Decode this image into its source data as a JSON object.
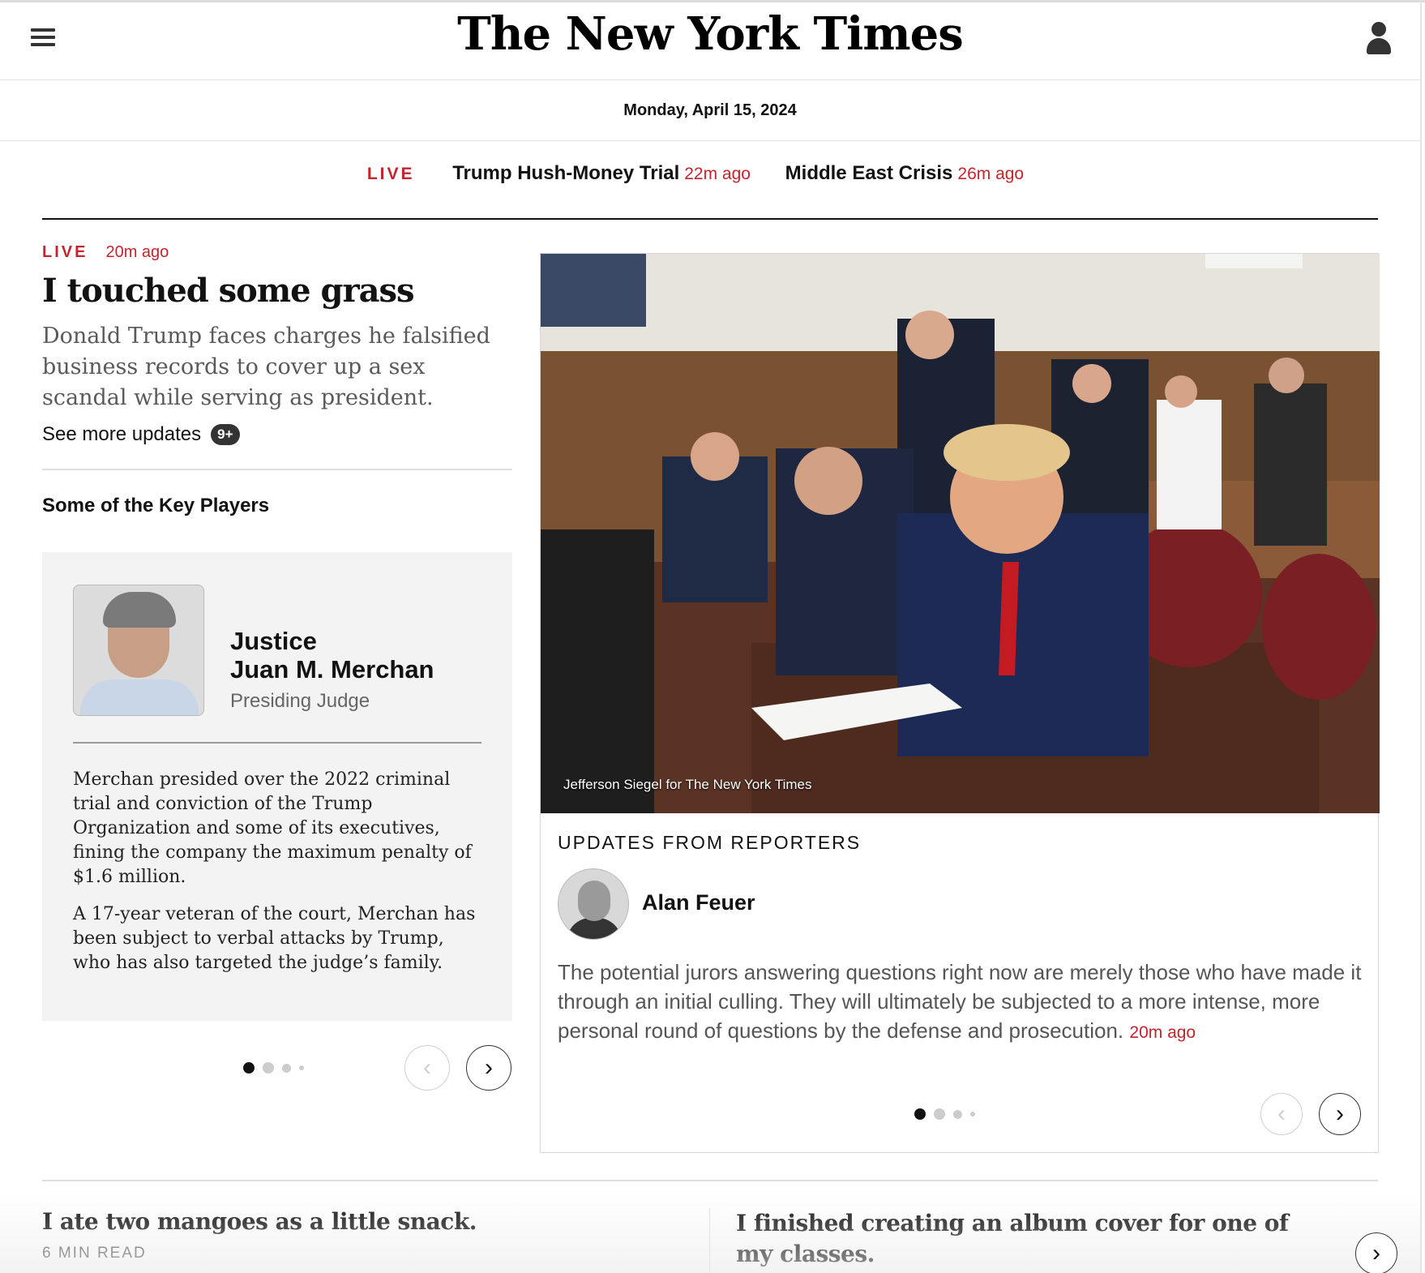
{
  "header": {
    "masthead": "The New York Times",
    "menu_icon": "hamburger-menu-icon",
    "account_icon": "user-account-icon"
  },
  "dateline": "Monday, April 15, 2024",
  "ticker": {
    "live_label": "LIVE",
    "items": [
      {
        "topic": "Trump Hush-Money Trial",
        "ago": "22m ago"
      },
      {
        "topic": "Middle East Crisis",
        "ago": "26m ago"
      }
    ]
  },
  "lead": {
    "live_label": "LIVE",
    "ago": "20m ago",
    "headline": "I touched some grass",
    "summary": "Donald Trump faces charges he falsified business records to cover up a sex scandal while serving as president.",
    "see_more": "See more updates",
    "badge": "9+"
  },
  "key_players": {
    "heading": "Some of the Key Players",
    "name_line1": "Justice",
    "name_line2": "Juan M. Merchan",
    "role": "Presiding Judge",
    "paragraphs": [
      "Merchan presided over the 2022 criminal trial and conviction of the Trump Organization and some of its executives, fining the company the maximum penalty of $1.6 million.",
      "A 17-year veteran of the court, Merchan has been subject to verbal attacks by Trump, who has also targeted the judge’s family."
    ],
    "carousel_active": 1,
    "carousel_count": 4
  },
  "hero": {
    "credit": "Jefferson Siegel for The New York Times"
  },
  "updates": {
    "heading": "UPDATES FROM REPORTERS",
    "reporter": "Alan Feuer",
    "text": "The potential jurors answering questions right now are merely those who have made it through an initial culling. They will ultimately be subjected to a more intense, more personal round of questions by the defense and prosecution.",
    "ago": "20m ago",
    "carousel_active": 1,
    "carousel_count": 4
  },
  "stories": [
    {
      "headline": "I ate two mangoes as a little snack.",
      "meta": "6 MIN READ"
    },
    {
      "headline": "I finished creating an album cover for one of my classes."
    }
  ],
  "colors": {
    "live_red": "#c6242c",
    "text": "#121212",
    "card_bg": "#f3f3f4"
  }
}
